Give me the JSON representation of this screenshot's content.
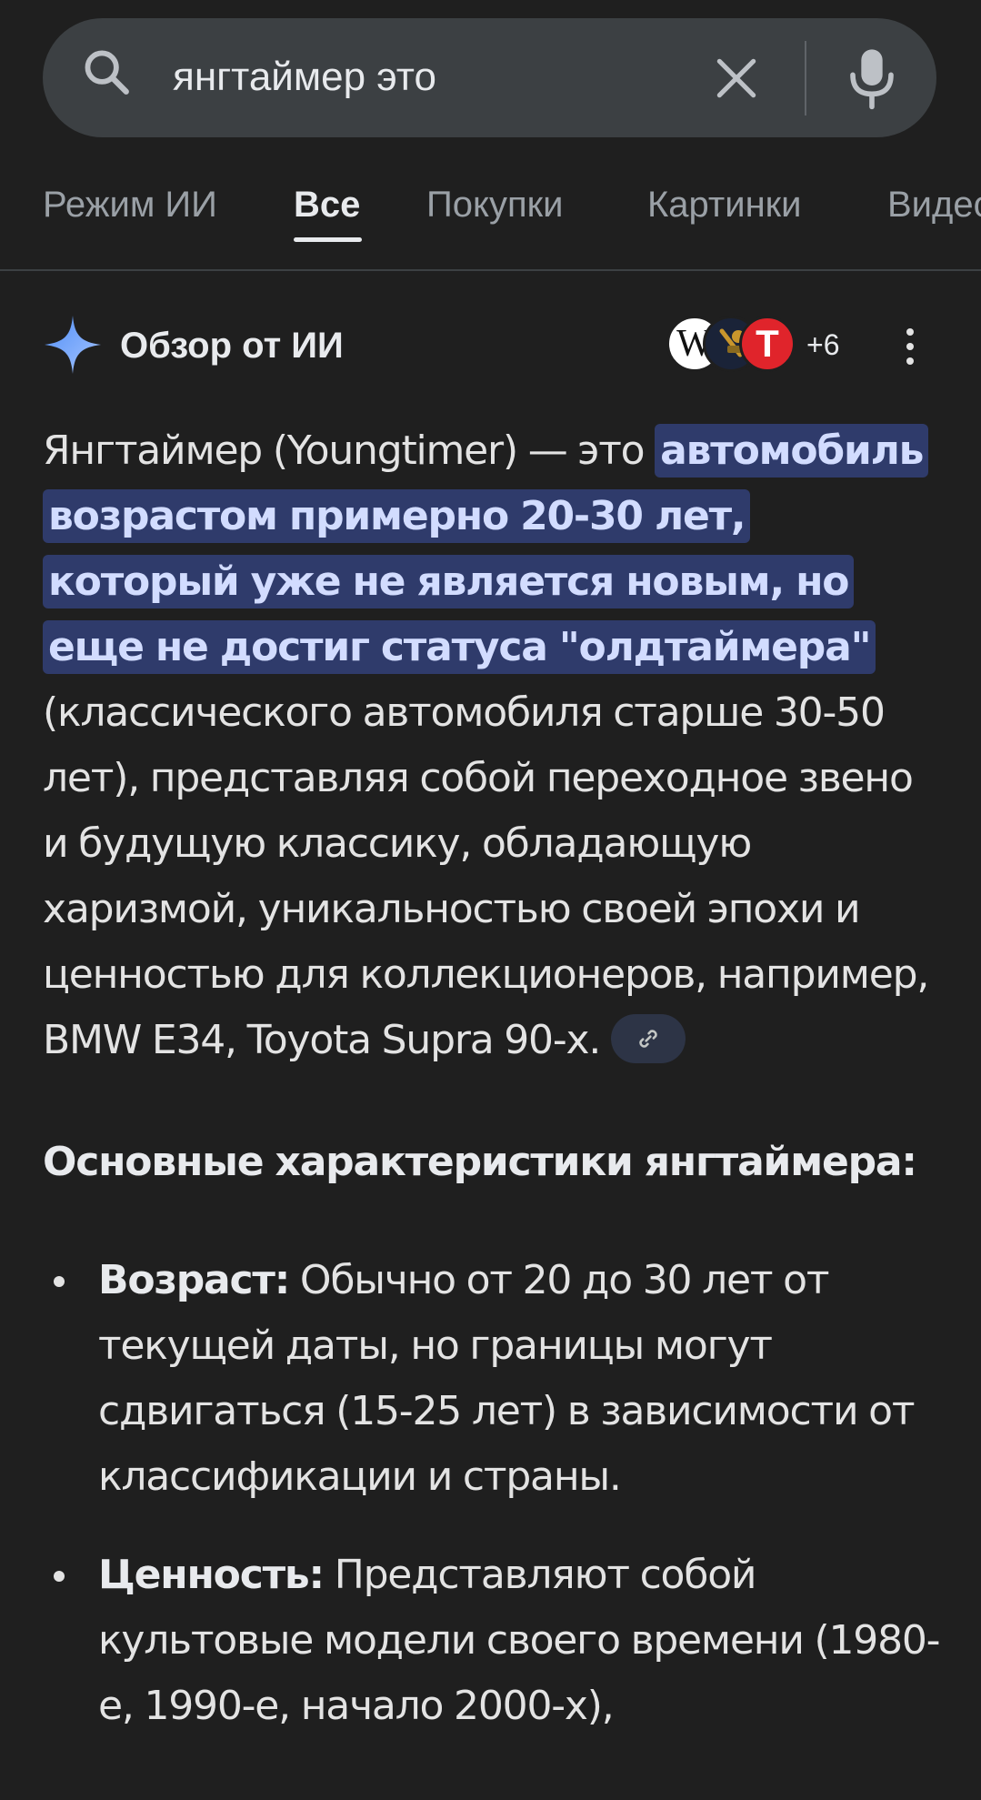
{
  "search": {
    "query": "янгтаймер это"
  },
  "tabs": [
    {
      "label": "Режим ИИ"
    },
    {
      "label": "Все"
    },
    {
      "label": "Покупки"
    },
    {
      "label": "Картинки"
    },
    {
      "label": "Видео"
    }
  ],
  "active_tab": "Все",
  "ai_overview": {
    "title": "Обзор от ИИ",
    "sources": {
      "avatars": [
        "wikipedia-icon",
        "site-logo-icon",
        "t-logo-icon"
      ],
      "avatar_w_letter": "W",
      "avatar_t_letter": "T",
      "more_count": "+6"
    },
    "intro_before": "Янгтаймер (Youngtimer) — это ",
    "intro_highlight": "автомобиль возрастом примерно 20-30 лет, который уже не является новым, но еще не достиг статуса \"олдтаймера\"",
    "intro_after": " (классического автомобиля старше 30-50 лет), представляя собой переходное звено и будущую классику, обладающую харизмой, уникальностью своей эпохи и ценностью для коллекционеров, например, BMW E34, Toyota Supra 90-х.",
    "section_heading": "Основные характеристики янгтаймера:",
    "bullets": [
      {
        "term": "Возраст:",
        "text": " Обычно от 20 до 30 лет от текущей даты, но границы могут сдвигаться (15-25 лет) в зависимости от классификации и страны."
      },
      {
        "term": "Ценность:",
        "text": " Представляют собой культовые модели своего времени (1980-е, 1990-е, начало 2000-х),"
      }
    ]
  },
  "colors": {
    "background": "#1f1f1f",
    "search_bar": "#3c4043",
    "highlight_bg": "#2f3b6b",
    "accent_blue": "#8ab4f8"
  }
}
